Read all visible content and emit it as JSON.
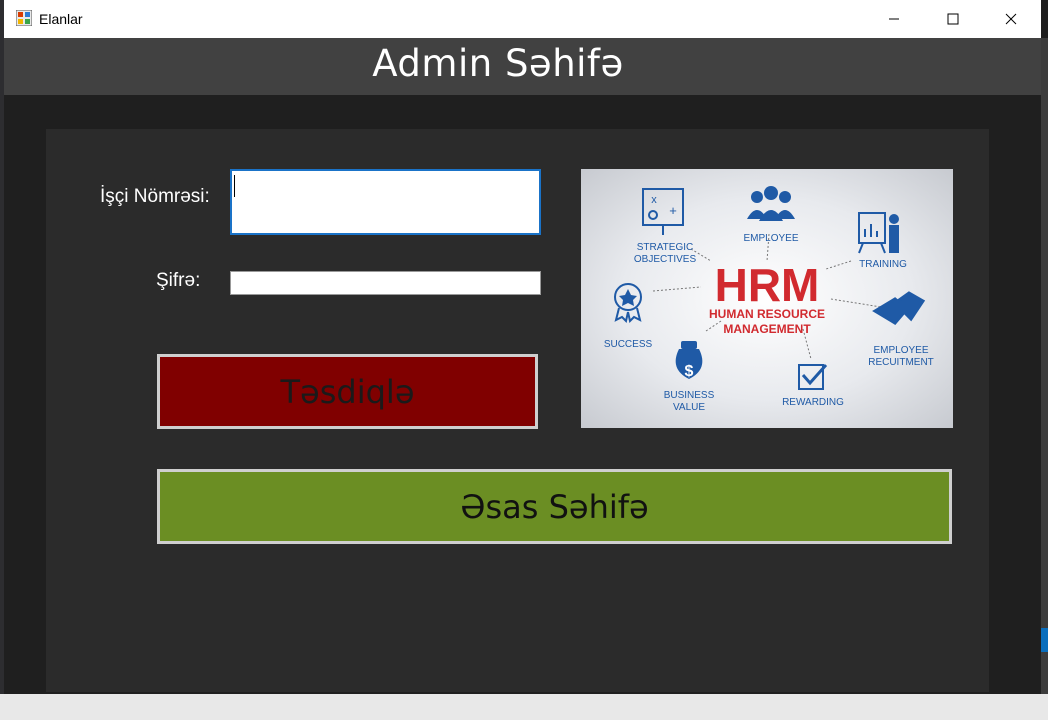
{
  "window": {
    "title": "Elanlar"
  },
  "header": {
    "title": "Admin Səhifə"
  },
  "form": {
    "employee_number_label": "İşçi Nömrəsi:",
    "employee_number_value": "",
    "password_label": "Şifrə:",
    "password_value": ""
  },
  "buttons": {
    "confirm_label": "Təsdiqlə",
    "home_label": "Əsas Səhifə"
  },
  "hrm_image": {
    "big_letters": "HRM",
    "subtitle_line1": "HUMAN RESOURCE",
    "subtitle_line2": "MANAGEMENT",
    "items": {
      "strategic_1": "STRATEGIC",
      "strategic_2": "OBJECTIVES",
      "employee": "EMPLOYEE",
      "training": "TRAINING",
      "success": "SUCCESS",
      "recruit_1": "EMPLOYEE",
      "recruit_2": "RECUITMENT",
      "business_1": "BUSINESS",
      "business_2": "VALUE",
      "rewarding": "REWARDING"
    }
  },
  "colors": {
    "confirm_bg": "#800000",
    "home_bg": "#6b8e23",
    "header_bg": "#414141",
    "hrm_red": "#d12a2f",
    "hrm_blue": "#1f5aa6"
  }
}
